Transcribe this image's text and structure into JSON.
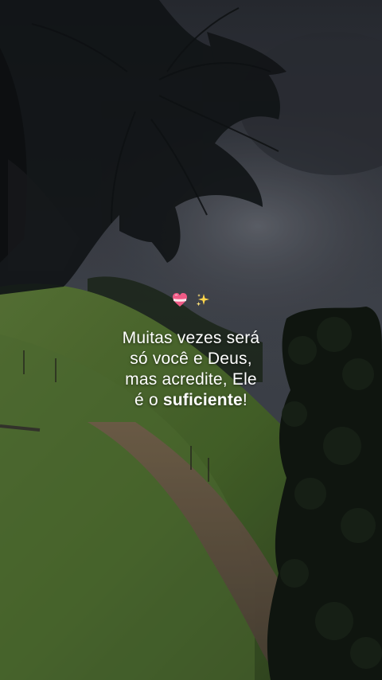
{
  "quote": {
    "line1": "Muitas vezes será",
    "line2": "só você e Deus,",
    "line3": "mas acredite, Ele",
    "line4_prefix": "é o ",
    "line4_bold": "suficiente",
    "line4_suffix": "!"
  },
  "icons": {
    "heart": "heart-with-ribbon-icon",
    "sparkles": "sparkles-icon"
  },
  "colors": {
    "text": "#ffffff",
    "sky": "#3a3d45",
    "grass": "#4d6b2e",
    "path": "#6b5a45"
  }
}
